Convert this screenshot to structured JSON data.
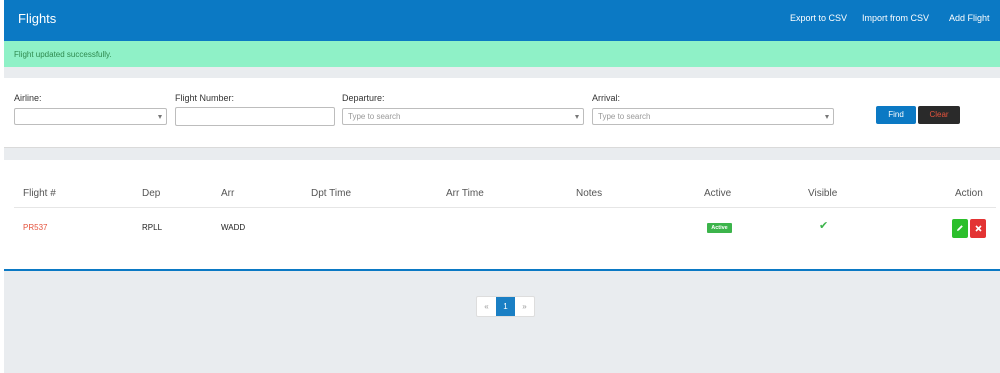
{
  "header": {
    "title": "Flights",
    "export_label": "Export to CSV",
    "import_label": "Import from CSV",
    "add_label": "Add Flight"
  },
  "alert": {
    "message": "Flight updated successfully."
  },
  "filters": {
    "airline": {
      "label": "Airline:",
      "value": ""
    },
    "flight_number": {
      "label": "Flight Number:",
      "value": ""
    },
    "departure": {
      "label": "Departure:",
      "placeholder": "Type to search"
    },
    "arrival": {
      "label": "Arrival:",
      "placeholder": "Type to search"
    },
    "find_label": "Find",
    "clear_label": "Clear"
  },
  "table": {
    "columns": [
      "Flight #",
      "Dep",
      "Arr",
      "Dpt Time",
      "Arr Time",
      "Notes",
      "Active",
      "Visible",
      "Action"
    ],
    "rows": [
      {
        "flight": "PR537",
        "dep": "RPLL",
        "arr": "WADD",
        "dpt_time": "",
        "arr_time": "",
        "notes": "",
        "active": "Active",
        "visible": "✔"
      }
    ]
  },
  "pagination": {
    "prev": "«",
    "current": "1",
    "next": "»"
  },
  "colors": {
    "primary": "#0b79c4",
    "alert_bg": "#8ff1c7",
    "success": "#3cb44b",
    "danger": "#e33333"
  }
}
